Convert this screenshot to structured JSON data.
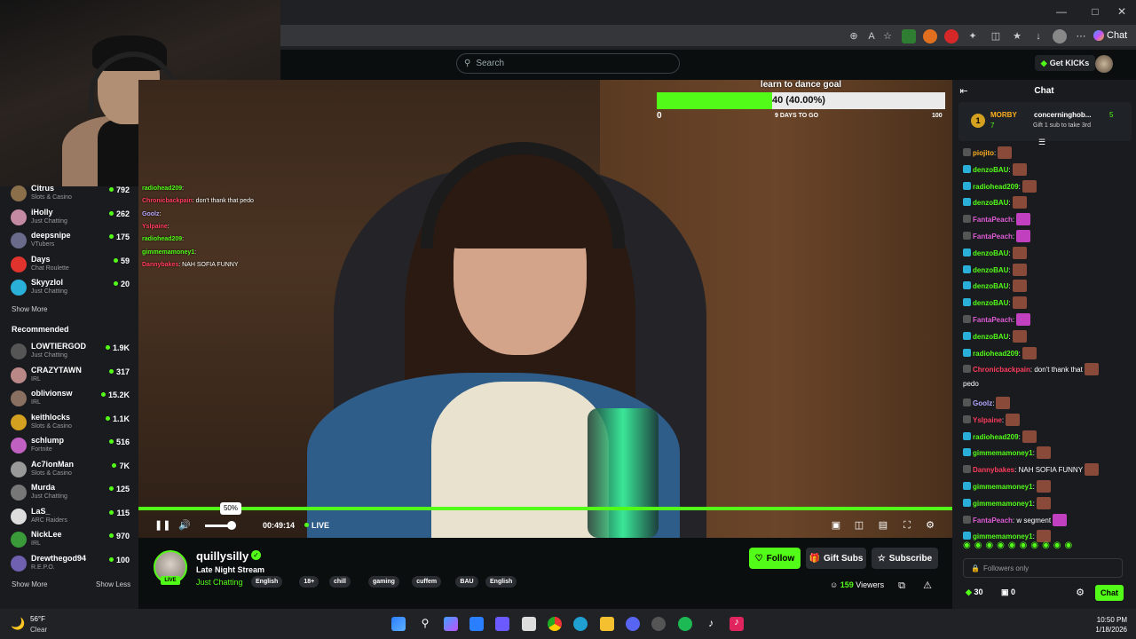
{
  "browser": {
    "chat_label": "Chat"
  },
  "header": {
    "search_placeholder": "Search",
    "get_kicks_label": "Get KICKs"
  },
  "sidebar": {
    "following": [
      {
        "name": "Citrus",
        "category": "Slots & Casino",
        "viewers": "792",
        "color": "#8a6f4a"
      },
      {
        "name": "iHolly",
        "category": "Just Chatting",
        "viewers": "262",
        "color": "#c48aa4"
      },
      {
        "name": "deepsnipe",
        "category": "VTubers",
        "viewers": "175",
        "color": "#6a6a8a"
      },
      {
        "name": "Days",
        "category": "Chat Roulette",
        "viewers": "59",
        "color": "#e0332e"
      },
      {
        "name": "Skyyzlol",
        "category": "Just Chatting",
        "viewers": "20",
        "color": "#2ab0d8"
      }
    ],
    "show_more_label": "Show More",
    "recommended_heading": "Recommended",
    "recommended": [
      {
        "name": "LOWTIERGOD",
        "category": "Just Chatting",
        "viewers": "1.9K",
        "color": "#555"
      },
      {
        "name": "CRAZYTAWN",
        "category": "IRL",
        "viewers": "317",
        "color": "#b88"
      },
      {
        "name": "oblivionsw",
        "category": "IRL",
        "viewers": "15.2K",
        "color": "#8a7060"
      },
      {
        "name": "keithlocks",
        "category": "Slots & Casino",
        "viewers": "1.1K",
        "color": "#d4a020"
      },
      {
        "name": "schlump",
        "category": "Fortnite",
        "viewers": "516",
        "color": "#c060c0"
      },
      {
        "name": "Ac7ionMan",
        "category": "Slots & Casino",
        "viewers": "7K",
        "color": "#999"
      },
      {
        "name": "Murda",
        "category": "Just Chatting",
        "viewers": "125",
        "color": "#777"
      },
      {
        "name": "LaS_",
        "category": "ARC Raiders",
        "viewers": "115",
        "color": "#dddddd"
      },
      {
        "name": "NickLee",
        "category": "IRL",
        "viewers": "970",
        "color": "#3a9a3a"
      },
      {
        "name": "Drewthegod94",
        "category": "R.E.P.O.",
        "viewers": "100",
        "color": "#7060b0"
      }
    ],
    "show_more_bottom": "Show More",
    "show_less": "Show Less"
  },
  "goal": {
    "title": "learn to dance goal",
    "progress_text": "40 (40.00%)",
    "progress_fraction": 0.4,
    "min": "0",
    "max": "100",
    "days_left": "9 DAYS TO GO"
  },
  "overlay_chat": [
    {
      "user": "radiohead209",
      "text": ":",
      "style": "n"
    },
    {
      "user": "Chronicbackpain",
      "text": ": don't thank that pedo",
      "style": "nr"
    },
    {
      "user": "Goolz",
      "text": ":",
      "style": "np"
    },
    {
      "user": "Yslpaine",
      "text": ":",
      "style": "nr"
    },
    {
      "user": "radiohead209",
      "text": ":",
      "style": "n"
    },
    {
      "user": "gimmemamoney1",
      "text": ":",
      "style": "n"
    },
    {
      "user": "Dannybakes",
      "text": ": NAH SOFIA FUNNY",
      "style": "nr"
    }
  ],
  "player": {
    "volume_tooltip": "50%",
    "volume_fraction": 0.5,
    "elapsed": "00:49:14",
    "live_label": "LIVE"
  },
  "stream": {
    "streamer": "quillysilly",
    "live_badge": "LIVE",
    "title": "Late Night Stream",
    "category": "Just Chatting",
    "tags": [
      "English",
      "18+",
      "chill",
      "gaming",
      "cuffem",
      "BAU",
      "English"
    ],
    "follow_label": "Follow",
    "gift_subs_label": "Gift Subs",
    "subscribe_label": "Subscribe",
    "viewers_count": "159",
    "viewers_label": "Viewers"
  },
  "chat": {
    "title": "Chat",
    "pinned": {
      "rank": "1",
      "first_name": "MORBY",
      "first_count": "7",
      "second_name": "concerninghob...",
      "second_count": "5",
      "gift_note": "Gift 1 sub to take 3rd"
    },
    "messages": [
      {
        "user": "piojito",
        "text": ":",
        "color": "#ffb020"
      },
      {
        "user": "denzoBAU",
        "text": ":",
        "color": "#53fc18"
      },
      {
        "user": "radiohead209",
        "text": ":",
        "color": "#53fc18"
      },
      {
        "user": "denzoBAU",
        "text": ":",
        "color": "#53fc18"
      },
      {
        "user": "FantaPeach",
        "text": ":",
        "color": "#e05cd6"
      },
      {
        "user": "FantaPeach",
        "text": ":",
        "color": "#e05cd6"
      },
      {
        "user": "denzoBAU",
        "text": ":",
        "color": "#53fc18"
      },
      {
        "user": "denzoBAU",
        "text": ":",
        "color": "#53fc18"
      },
      {
        "user": "denzoBAU",
        "text": ":",
        "color": "#53fc18"
      },
      {
        "user": "denzoBAU",
        "text": ":",
        "color": "#53fc18"
      },
      {
        "user": "FantaPeach",
        "text": ":",
        "color": "#e05cd6"
      },
      {
        "user": "denzoBAU",
        "text": ":",
        "color": "#53fc18"
      },
      {
        "user": "radiohead209",
        "text": ":",
        "color": "#53fc18"
      },
      {
        "user": "Chronicbackpain",
        "text": ": don't thank that",
        "color": "#ff3b5c"
      },
      {
        "user": "",
        "text": "pedo",
        "color": "#ffffff"
      },
      {
        "user": "Goolz",
        "text": ":",
        "color": "#b4a7ff"
      },
      {
        "user": "Yslpaine",
        "text": ":",
        "color": "#ff3b5c"
      },
      {
        "user": "radiohead209",
        "text": ":",
        "color": "#53fc18"
      },
      {
        "user": "gimmemamoney1",
        "text": ":",
        "color": "#53fc18"
      },
      {
        "user": "Dannybakes",
        "text": ": NAH SOFIA FUNNY",
        "color": "#ff3b5c"
      },
      {
        "user": "gimmemamoney1",
        "text": ":",
        "color": "#53fc18"
      },
      {
        "user": "gimmemamoney1",
        "text": ":",
        "color": "#53fc18"
      },
      {
        "user": "FantaPeach",
        "text": ": w segment",
        "color": "#e05cd6"
      },
      {
        "user": "gimmemamoney1",
        "text": ":",
        "color": "#53fc18"
      }
    ],
    "input_placeholder": "Followers only",
    "kicks_count": "30",
    "points_count": "0",
    "send_label": "Chat"
  },
  "taskbar": {
    "temperature": "56°F",
    "weather": "Clear",
    "time": "10:50 PM",
    "date": "1/18/2026"
  }
}
